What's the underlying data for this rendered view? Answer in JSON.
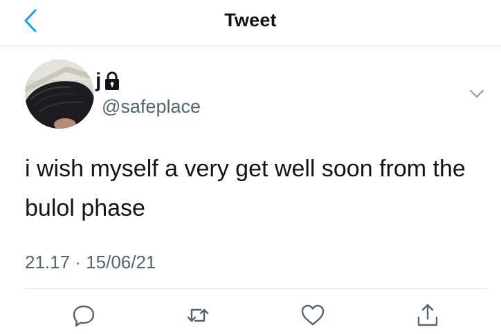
{
  "header": {
    "title": "Tweet",
    "back_icon": "chevron-left-icon"
  },
  "tweet": {
    "author": {
      "display_name": "j",
      "protected_icon": "lock-icon",
      "handle": "@safeplace"
    },
    "text": "i wish myself a very get well soon from the bulol phase",
    "timestamp": "21.17 · 15/06/21"
  },
  "actions": [
    {
      "name": "reply",
      "icon": "reply-icon"
    },
    {
      "name": "retweet",
      "icon": "retweet-icon"
    },
    {
      "name": "like",
      "icon": "heart-icon"
    },
    {
      "name": "share",
      "icon": "share-icon"
    }
  ],
  "colors": {
    "accent": "#1d9bf0",
    "text_primary": "#0f1419",
    "text_secondary": "#536471",
    "divider": "#dfe3e6"
  }
}
